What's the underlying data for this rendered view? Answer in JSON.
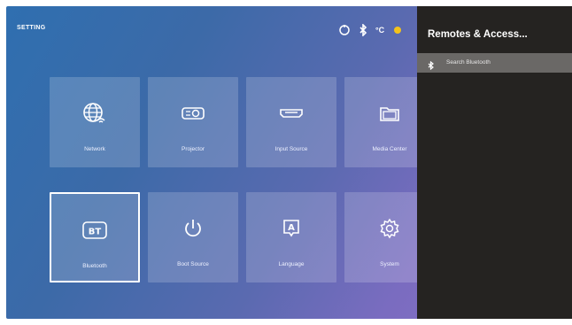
{
  "header": {
    "title": "SETTING",
    "temperature_unit": "°C"
  },
  "tiles": [
    {
      "label": "Network",
      "icon": "globe-wifi-icon"
    },
    {
      "label": "Projector",
      "icon": "projector-icon"
    },
    {
      "label": "Input Source",
      "icon": "hdmi-port-icon"
    },
    {
      "label": "Media Center",
      "icon": "folder-icon"
    },
    {
      "label": "Bluetooth",
      "icon": "bluetooth-bt-icon",
      "selected": true
    },
    {
      "label": "Boot Source",
      "icon": "power-icon"
    },
    {
      "label": "Language",
      "icon": "language-a-icon"
    },
    {
      "label": "System",
      "icon": "gear-icon"
    }
  ],
  "panel": {
    "title": "Remotes & Access...",
    "items": [
      {
        "label": "Search Bluetooth",
        "icon": "bluetooth-icon"
      }
    ]
  },
  "colors": {
    "panel_bg": "#252321",
    "panel_item_bg": "#6a6866",
    "accent_sun": "#f3c21b"
  }
}
